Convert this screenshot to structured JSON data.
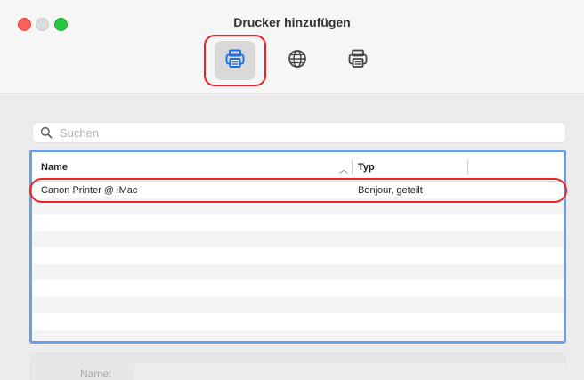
{
  "window": {
    "title": "Drucker hinzufügen"
  },
  "toolbar": {
    "buttons": [
      {
        "icon": "printer-icon",
        "selected": true
      },
      {
        "icon": "globe-icon",
        "selected": false
      },
      {
        "icon": "windows-printer-icon",
        "selected": false
      }
    ]
  },
  "search": {
    "placeholder": "Suchen",
    "value": ""
  },
  "table": {
    "columns": [
      "Name",
      "Typ"
    ],
    "rows": [
      {
        "name": "Canon Printer @ iMac",
        "type": "Bonjour, geteilt"
      }
    ]
  },
  "details": {
    "name_label": "Name:"
  },
  "colors": {
    "selection_border": "#6a9ee8",
    "highlight": "#e8232a"
  }
}
